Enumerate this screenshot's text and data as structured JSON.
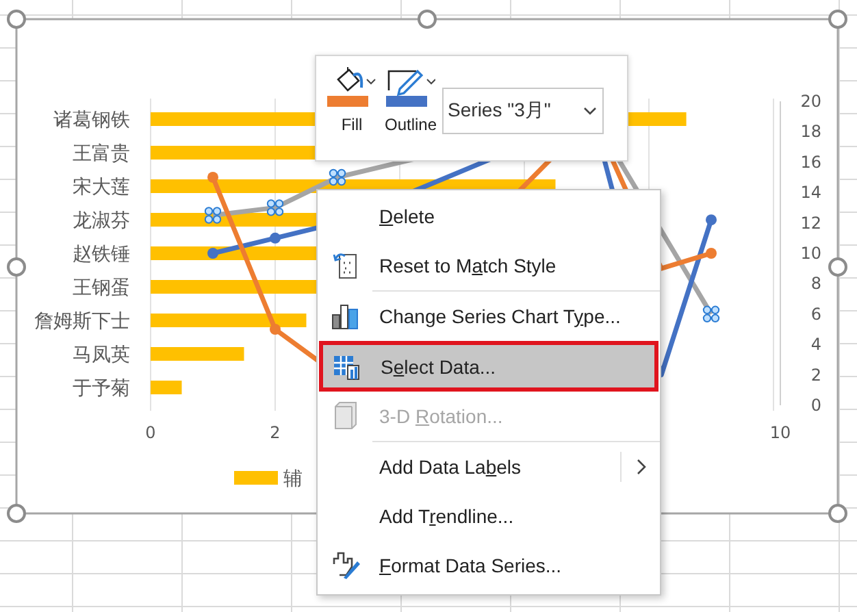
{
  "chart": {
    "categories": [
      "诸葛钢铁",
      "王富贵",
      "宋大莲",
      "龙淑芬",
      "赵铁锤",
      "王钢蛋",
      "詹姆斯下士",
      "马凤英",
      "于予菊"
    ],
    "x_ticks": [
      "0",
      "2",
      "10"
    ],
    "right_ticks": [
      "20",
      "18",
      "16",
      "14",
      "12",
      "10",
      "8",
      "6",
      "4",
      "2",
      "0"
    ],
    "legend": "辅"
  },
  "toolbar": {
    "buttons": [
      {
        "kind": "fill",
        "label": "Fill",
        "color": "#ed7d31"
      },
      {
        "kind": "outline",
        "label": "Outline",
        "color": "#4472c4"
      }
    ],
    "series_select": {
      "value": "Series \"3月\""
    }
  },
  "menu": {
    "items": [
      {
        "kind": "delete",
        "key": "D",
        "after": "elete",
        "selected": false,
        "disabled": false,
        "submenu": false
      },
      {
        "kind": "reset",
        "before": "Reset to M",
        "key": "a",
        "after": "tch Style",
        "selected": false,
        "disabled": false,
        "submenu": false
      },
      {
        "kind": "separator"
      },
      {
        "kind": "chart-type",
        "before": "Change Series Chart T",
        "key": "y",
        "after": "pe...",
        "selected": false,
        "disabled": false,
        "submenu": false
      },
      {
        "kind": "select-data",
        "before": "S",
        "key": "e",
        "after": "lect Data...",
        "selected": true,
        "disabled": false,
        "submenu": false
      },
      {
        "kind": "rotation",
        "before": "3-D ",
        "key": "R",
        "after": "otation...",
        "selected": false,
        "disabled": true,
        "submenu": false
      },
      {
        "kind": "separator"
      },
      {
        "kind": "labels",
        "before": "Add Data La",
        "key": "b",
        "after": "els",
        "selected": false,
        "disabled": false,
        "submenu": true
      },
      {
        "kind": "trendline",
        "before": "Add T",
        "key": "r",
        "after": "endline...",
        "selected": false,
        "disabled": false,
        "submenu": false
      },
      {
        "kind": "format",
        "key": "F",
        "after": "ormat Data Series...",
        "selected": false,
        "disabled": false,
        "submenu": false
      }
    ]
  }
}
